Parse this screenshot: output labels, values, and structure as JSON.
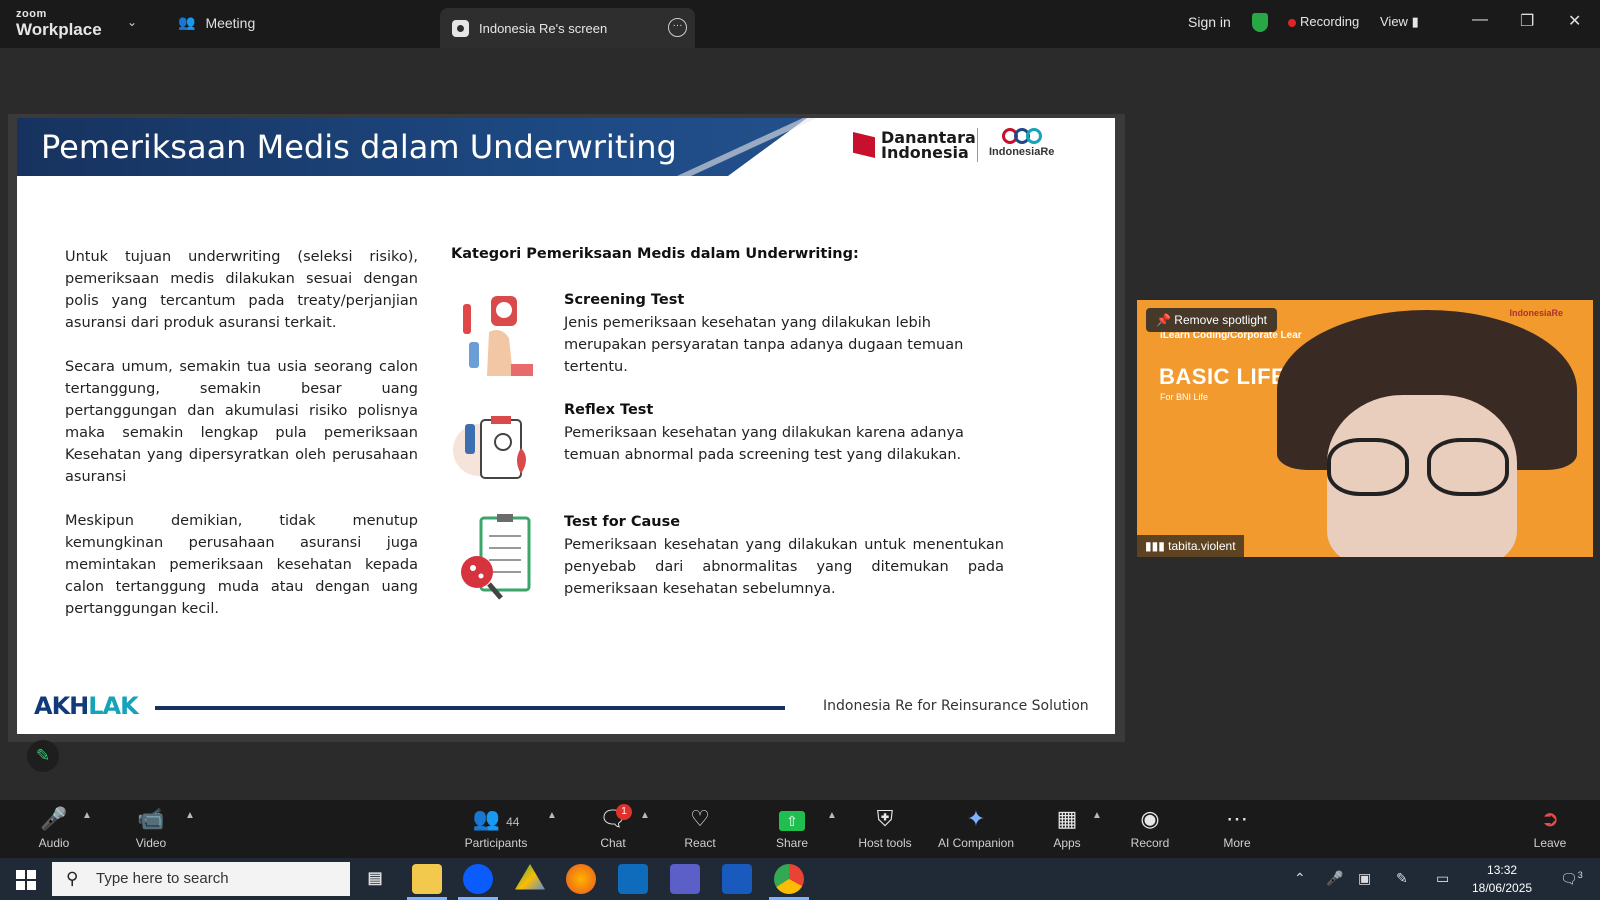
{
  "topbar": {
    "brand_top": "zoom",
    "brand_bottom": "Workplace",
    "meeting_label": "Meeting",
    "share_tab_label": "Indonesia Re's screen",
    "sign_in": "Sign in",
    "recording": "Recording",
    "view": "View"
  },
  "slide": {
    "title": "Pemeriksaan Medis dalam Underwriting",
    "logo_danantara": "Danantara Indonesia",
    "logo_indonesiare": "IndonesiaRe",
    "paragraphs": [
      "Untuk tujuan underwriting (seleksi risiko), pemeriksaan medis dilakukan sesuai dengan polis yang tercantum pada treaty/perjanjian asuransi dari produk asuransi terkait.",
      "Secara umum, semakin tua usia seorang calon tertanggung, semakin besar uang pertanggungan dan akumulasi risiko polisnya maka semakin lengkap pula pemeriksaan Kesehatan yang dipersyratkan oleh perusahaan asuransi",
      "Meskipun demikian, tidak menutup kemungkinan perusahaan asuransi juga memintakan pemeriksaan kesehatan kepada calon tertanggung muda atau dengan uang pertanggungan kecil."
    ],
    "category_heading": "Kategori Pemeriksaan Medis dalam Underwriting:",
    "items": [
      {
        "title": "Screening Test",
        "desc": "Jenis pemeriksaan kesehatan yang dilakukan lebih merupakan persyaratan tanpa adanya dugaan temuan tertentu."
      },
      {
        "title": "Reflex Test",
        "desc": "Pemeriksaan kesehatan yang dilakukan karena adanya temuan abnormal pada screening test yang dilakukan."
      },
      {
        "title": "Test for Cause",
        "desc": "Pemeriksaan kesehatan yang dilakukan untuk menentukan penyebab dari abnormalitas yang ditemukan pada pemeriksaan kesehatan sebelumnya."
      }
    ],
    "footer_logo_a": "AKH",
    "footer_logo_b": "LAK",
    "footer_text": "Indonesia Re for Reinsurance Solution"
  },
  "video": {
    "spotlight_label": "Remove spotlight",
    "participant_name": "tabita.violent",
    "bg_line1": "iLearn Coding/Corporate Lear",
    "bg_line2": "BASIC LIFE AND",
    "bg_line3": "For BNI Life",
    "bg_logo": "IndonesiaRe"
  },
  "toolbar": {
    "audio": "Audio",
    "video": "Video",
    "participants": "Participants",
    "participants_count": "44",
    "chat": "Chat",
    "chat_badge": "1",
    "react": "React",
    "share": "Share",
    "host_tools": "Host tools",
    "ai_companion": "AI Companion",
    "apps": "Apps",
    "record": "Record",
    "more": "More",
    "leave": "Leave"
  },
  "taskbar": {
    "search_placeholder": "Type here to search",
    "time": "13:32",
    "date": "18/06/2025",
    "notif_count": "3"
  },
  "colors": {
    "banner": "#17325e",
    "zoom_blue": "#0b5cff",
    "share_green": "#1fbf4f",
    "recording_red": "#e02424",
    "video_bg": "#f29a2e"
  }
}
